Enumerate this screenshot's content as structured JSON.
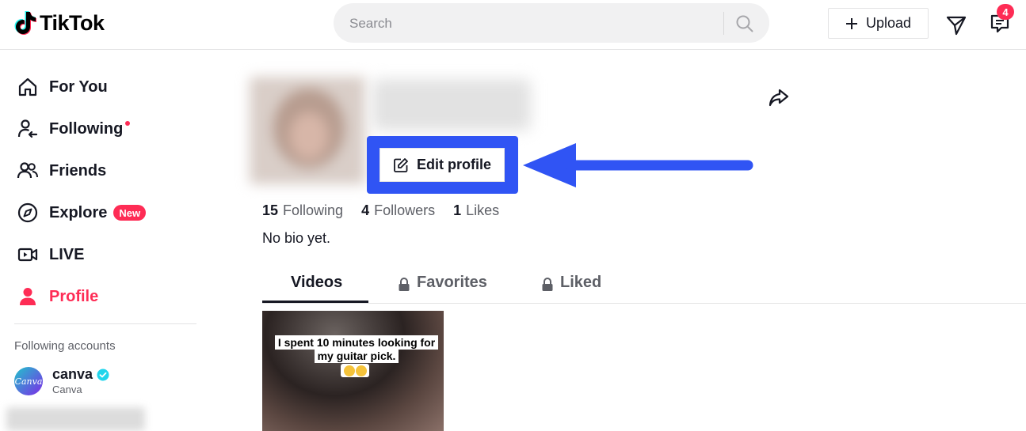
{
  "header": {
    "logo_text": "TikTok",
    "search": {
      "placeholder": "Search"
    },
    "upload_label": "Upload",
    "inbox_badge": "4"
  },
  "sidebar": {
    "items": [
      {
        "label": "For You",
        "icon": "home-icon"
      },
      {
        "label": "Following",
        "icon": "following-icon",
        "has_dot": true
      },
      {
        "label": "Friends",
        "icon": "friends-icon"
      },
      {
        "label": "Explore",
        "icon": "compass-icon",
        "badge": "New"
      },
      {
        "label": "LIVE",
        "icon": "live-icon"
      },
      {
        "label": "Profile",
        "icon": "profile-icon",
        "active": true
      }
    ],
    "following_heading": "Following accounts",
    "accounts": [
      {
        "name": "canva",
        "subtitle": "Canva",
        "avatar_text": "Canva",
        "verified": true
      }
    ]
  },
  "profile": {
    "edit_label": "Edit profile",
    "stats": [
      {
        "value": "15",
        "label": "Following"
      },
      {
        "value": "4",
        "label": "Followers"
      },
      {
        "value": "1",
        "label": "Likes"
      }
    ],
    "bio": "No bio yet.",
    "tabs": [
      {
        "label": "Videos",
        "active": true,
        "locked": false
      },
      {
        "label": "Favorites",
        "active": false,
        "locked": true
      },
      {
        "label": "Liked",
        "active": false,
        "locked": true
      }
    ],
    "videos": [
      {
        "caption": "I spent 10 minutes looking for my guitar pick."
      }
    ]
  },
  "colors": {
    "accent": "#fe2c55",
    "annotation_blue": "#3054f4"
  }
}
